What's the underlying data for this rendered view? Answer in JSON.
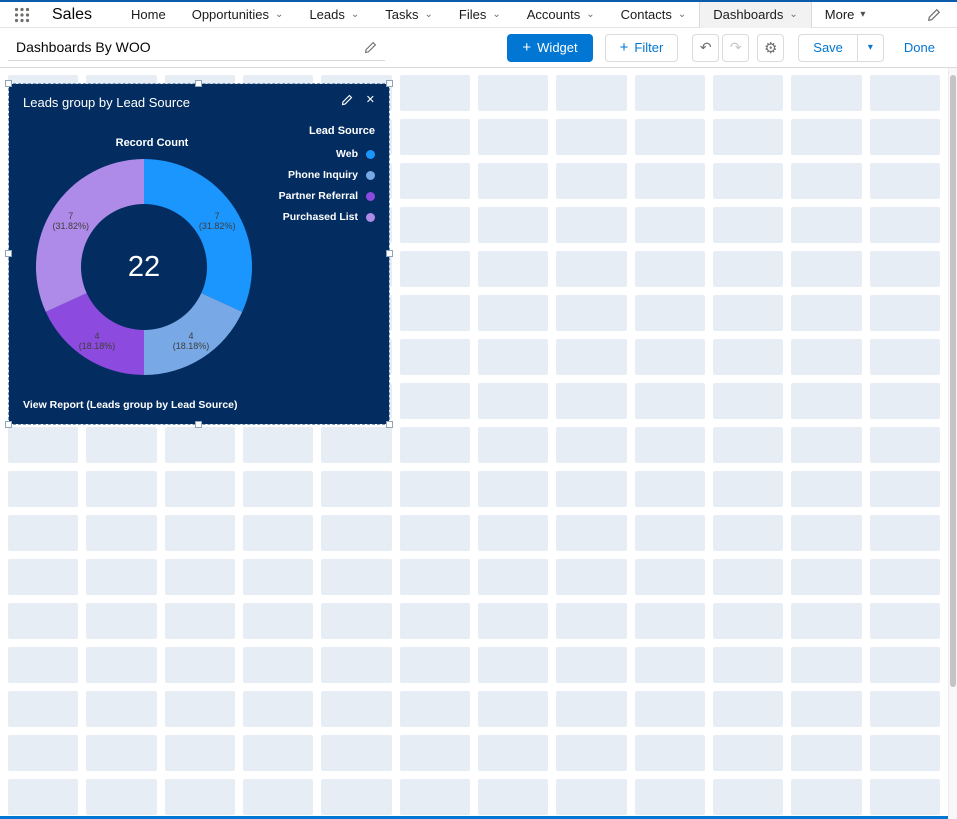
{
  "nav": {
    "app_name": "Sales",
    "tabs": [
      {
        "label": "Home",
        "caret": "none",
        "active": false
      },
      {
        "label": "Opportunities",
        "caret": "chevron",
        "active": false
      },
      {
        "label": "Leads",
        "caret": "chevron",
        "active": false
      },
      {
        "label": "Tasks",
        "caret": "chevron",
        "active": false
      },
      {
        "label": "Files",
        "caret": "chevron",
        "active": false
      },
      {
        "label": "Accounts",
        "caret": "chevron",
        "active": false
      },
      {
        "label": "Contacts",
        "caret": "chevron",
        "active": false
      },
      {
        "label": "Dashboards",
        "caret": "chevron",
        "active": true
      },
      {
        "label": "More",
        "caret": "triangle",
        "active": false
      }
    ]
  },
  "toolbar": {
    "dashboard_title": "Dashboards By WOO",
    "widget_button": "Widget",
    "filter_button": "Filter",
    "save_button": "Save",
    "done_button": "Done"
  },
  "icons": {
    "plus": "+",
    "undo": "↶",
    "redo": "↷",
    "gear": "⚙",
    "caret_down": "▾",
    "chevron_down": "⌄",
    "close": "✕"
  },
  "widget": {
    "title": "Leads group by Lead Source",
    "value_axis_label": "Record Count",
    "center_total": "22",
    "footer_link": "View Report (Leads group by Lead Source)",
    "legend_title": "Lead Source"
  },
  "chart_data": {
    "type": "pie",
    "subtype": "donut",
    "title": "Leads group by Lead Source",
    "measure": "Record Count",
    "total": 22,
    "categories": [
      "Web",
      "Phone Inquiry",
      "Partner Referral",
      "Purchased List"
    ],
    "values": [
      7,
      4,
      4,
      7
    ],
    "percent_labels": [
      "31.82%",
      "18.18%",
      "18.18%",
      "31.82%"
    ],
    "colors": [
      "#1B96FF",
      "#78A9E6",
      "#8C4BDE",
      "#AE8BE8"
    ],
    "center_text": "22",
    "legend_position": "right",
    "slice_label_color": "#3e3e3c"
  },
  "colors": {
    "brand": "#0176d3",
    "widget_bg": "#032D60",
    "grid_cell": "#e7edf4",
    "top_stripe": "#0b5cab"
  },
  "grid": {
    "columns": 12,
    "rows": 17
  }
}
